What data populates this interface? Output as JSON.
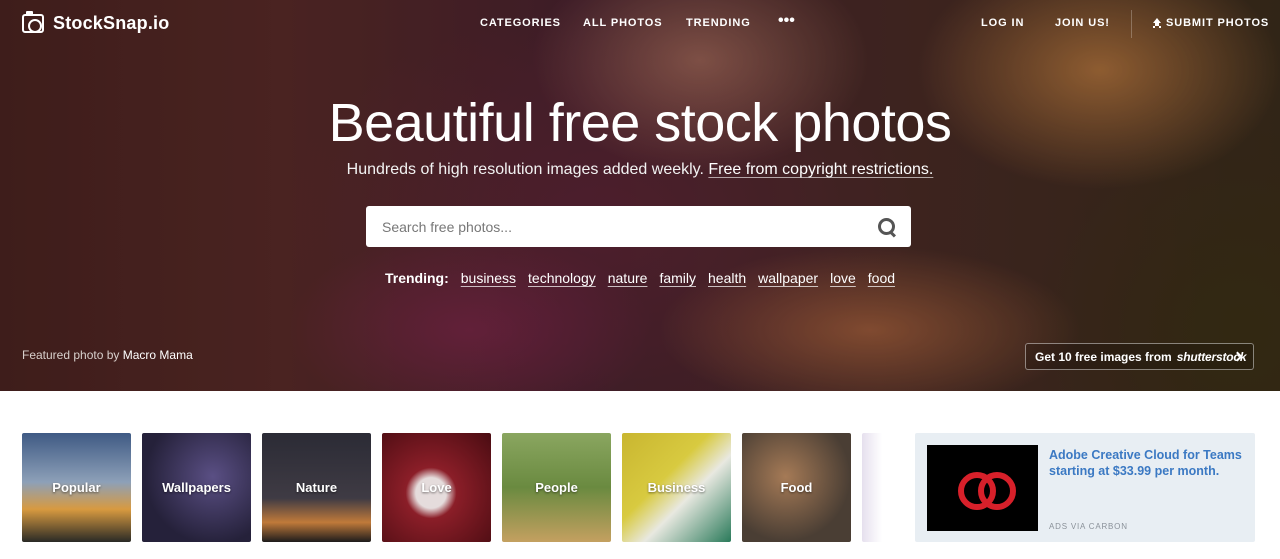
{
  "brand": {
    "name": "StockSnap.io"
  },
  "nav": {
    "categories": "CATEGORIES",
    "all_photos": "ALL PHOTOS",
    "trending": "TRENDING",
    "more": "•••",
    "login": "LOG IN",
    "join": "JOIN US!",
    "submit": "SUBMIT PHOTOS"
  },
  "hero": {
    "title": "Beautiful free stock photos",
    "subtitle_text": "Hundreds of high resolution images added weekly.",
    "subtitle_link": "Free from copyright restrictions."
  },
  "search": {
    "placeholder": "Search free photos...",
    "value": ""
  },
  "trending": {
    "label": "Trending:",
    "tags": [
      "business",
      "technology",
      "nature",
      "family",
      "health",
      "wallpaper",
      "love",
      "food"
    ]
  },
  "featured": {
    "prefix": "Featured photo by",
    "author": "Macro Mama"
  },
  "shutterstock_button": {
    "text": "Get 10 free images from",
    "brand": "shutterstock"
  },
  "categories": [
    "Popular",
    "Wallpapers",
    "Nature",
    "Love",
    "People",
    "Business",
    "Food"
  ],
  "ad": {
    "text": "Adobe Creative Cloud for Teams starting at $33.99 per month.",
    "via": "ADS VIA CARBON"
  }
}
